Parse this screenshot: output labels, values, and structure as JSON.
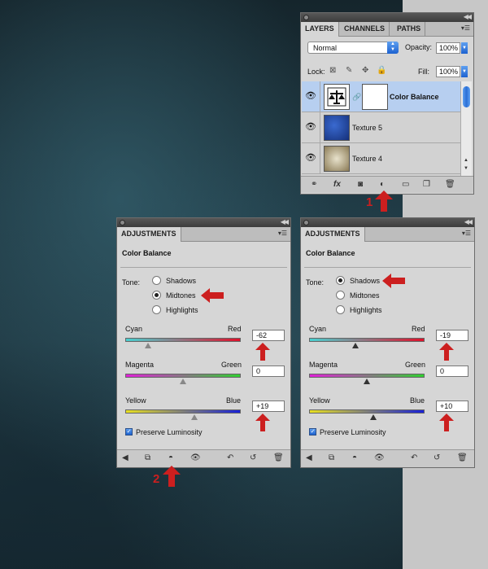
{
  "layers_panel": {
    "tabs": [
      "LAYERS",
      "CHANNELS",
      "PATHS"
    ],
    "blend_mode": "Normal",
    "opacity_label": "Opacity:",
    "opacity_value": "100%",
    "lock_label": "Lock:",
    "fill_label": "Fill:",
    "fill_value": "100%",
    "layers": [
      {
        "name": "Color Balance",
        "selected": true
      },
      {
        "name": "Texture 5",
        "selected": false
      },
      {
        "name": "Texture 4",
        "selected": false
      }
    ],
    "bottom_icons": [
      "link-icon",
      "fx-icon",
      "mask-icon",
      "adjustment-layer-icon",
      "group-icon",
      "new-layer-icon",
      "trash-icon"
    ],
    "fx_label": "fx"
  },
  "adjustments_left": {
    "tab": "ADJUSTMENTS",
    "title": "Color Balance",
    "tone_label": "Tone:",
    "tone_options": [
      "Shadows",
      "Midtones",
      "Highlights"
    ],
    "selected_tone": "Midtones",
    "sliders": [
      {
        "left": "Cyan",
        "right": "Red",
        "value": "-62"
      },
      {
        "left": "Magenta",
        "right": "Green",
        "value": "0"
      },
      {
        "left": "Yellow",
        "right": "Blue",
        "value": "+19"
      }
    ],
    "preserve_luminosity": "Preserve Luminosity"
  },
  "adjustments_right": {
    "tab": "ADJUSTMENTS",
    "title": "Color Balance",
    "tone_label": "Tone:",
    "tone_options": [
      "Shadows",
      "Midtones",
      "Highlights"
    ],
    "selected_tone": "Shadows",
    "sliders": [
      {
        "left": "Cyan",
        "right": "Red",
        "value": "-19"
      },
      {
        "left": "Magenta",
        "right": "Green",
        "value": "0"
      },
      {
        "left": "Yellow",
        "right": "Blue",
        "value": "+10"
      }
    ],
    "preserve_luminosity": "Preserve Luminosity"
  },
  "callouts": {
    "one": "1",
    "two": "2"
  },
  "colors": {
    "annotation_red": "#cc1f1f",
    "selected_layer": "#b7cff0",
    "accent_blue": "#1d62d0"
  }
}
